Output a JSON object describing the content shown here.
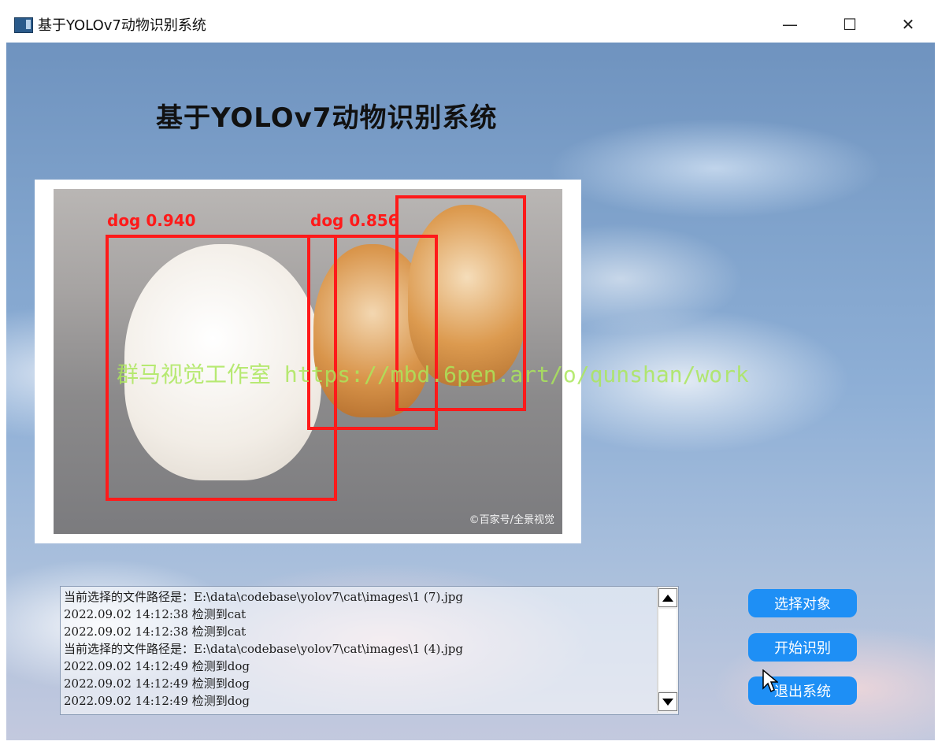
{
  "window": {
    "title": "基于YOLOv7动物识别系统",
    "controls": {
      "minimize": "—",
      "maximize": "☐",
      "close": "✕"
    }
  },
  "app": {
    "heading": "基于YOLOv7动物识别系统"
  },
  "detection": {
    "image_alt": "dogs",
    "boxes": [
      {
        "label": "dog 0.940"
      },
      {
        "label": "dog 0.856"
      },
      {
        "label": ""
      }
    ],
    "photo_credit": "©百家号/全景视觉",
    "watermark": "群马视觉工作室 https://mbd.6pen.art/o/qunshan/work"
  },
  "log": {
    "lines": [
      "当前选择的文件路径是：E:\\data\\codebase\\yolov7\\cat\\images\\1 (7).jpg",
      "2022.09.02 14:12:38 检测到cat",
      "2022.09.02 14:12:38 检测到cat",
      "当前选择的文件路径是：E:\\data\\codebase\\yolov7\\cat\\images\\1 (4).jpg",
      "2022.09.02 14:12:49 检测到dog",
      "2022.09.02 14:12:49 检测到dog",
      "2022.09.02 14:12:49 检测到dog"
    ]
  },
  "buttons": {
    "select": "选择对象",
    "start": "开始识别",
    "exit": "退出系统"
  },
  "colors": {
    "button_bg": "#1e8ff5",
    "bbox": "#ff1a1a",
    "watermark": "#aae65a"
  }
}
